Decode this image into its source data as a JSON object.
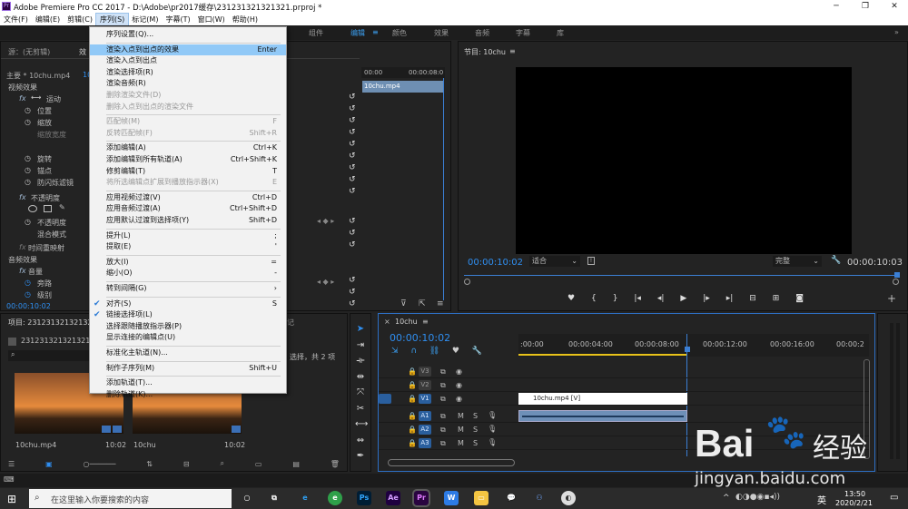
{
  "titlebar": {
    "title": "Adobe Premiere Pro CC 2017 - D:\\Adobe\\pr2017缓存\\231231321321321.prproj *",
    "minimize": "─",
    "restore": "❐",
    "close": "✕"
  },
  "menubar": [
    "文件(F)",
    "编辑(E)",
    "剪辑(C)",
    "序列(S)",
    "标记(M)",
    "字幕(T)",
    "窗口(W)",
    "帮助(H)"
  ],
  "workspaces": [
    "组件",
    "编辑",
    "颜色",
    "效果",
    "音频",
    "字幕",
    "库"
  ],
  "effect_controls": {
    "source_tab": "源：(无剪辑)",
    "effects_tab": "效",
    "master": "主要 * 10chu.mp4",
    "video_effects": "视频效果",
    "audio_effects": "音频效果",
    "timecode": "00:00:10:02",
    "motion": "运动",
    "position": "位置",
    "scale": "缩放",
    "scale_width": "缩放宽度",
    "rotation": "旋转",
    "anchor": "锚点",
    "anti_flicker": "防闪烁滤镜",
    "opacity": "不透明度",
    "opacity2": "不透明度",
    "blend": "混合模式",
    "time_remap": "时间重映射",
    "volume": "音量",
    "bypass": "旁路",
    "level": "级别",
    "mini_tc_start": "00:00",
    "mini_tc_end": "00:00:08:0",
    "clip": "10chu.mp4"
  },
  "program": {
    "tab": "节目: 10chu",
    "timecode": "00:00:10:02",
    "fit": "适合",
    "quality": "完整",
    "duration": "00:00:10:03"
  },
  "project": {
    "tab": "项目: 231231321321321",
    "tab2": "记",
    "name": "231231321321321.prproj",
    "selection_info": "选择，共 2 项",
    "items": [
      {
        "name": "10chu.mp4",
        "dur": "10:02"
      },
      {
        "name": "10chu",
        "dur": "10:02"
      }
    ]
  },
  "timeline": {
    "tab": "10chu",
    "timecode": "00:00:10:02",
    "ruler": [
      ":00:00",
      "00:00:04:00",
      "00:00:08:00",
      "00:00:12:00",
      "00:00:16:00",
      "00:00:2"
    ],
    "tracks": [
      {
        "name": "V3"
      },
      {
        "name": "V2"
      },
      {
        "name": "V1",
        "clip": "10chu.mp4 [V]"
      },
      {
        "name": "A1"
      },
      {
        "name": "A2"
      },
      {
        "name": "A3"
      }
    ]
  },
  "menu": {
    "items": [
      {
        "label": "序列设置(Q)...",
        "sc": "",
        "state": "normal"
      },
      {
        "sep": true
      },
      {
        "label": "渲染入点到出点的效果",
        "sc": "Enter",
        "state": "hl"
      },
      {
        "label": "渲染入点到出点",
        "sc": "",
        "state": "normal"
      },
      {
        "label": "渲染选择项(R)",
        "sc": "",
        "state": "normal"
      },
      {
        "label": "渲染音频(R)",
        "sc": "",
        "state": "normal"
      },
      {
        "label": "删除渲染文件(D)",
        "sc": "",
        "state": "dis"
      },
      {
        "label": "删除入点到出点的渲染文件",
        "sc": "",
        "state": "dis"
      },
      {
        "sep": true
      },
      {
        "label": "匹配帧(M)",
        "sc": "F",
        "state": "dis"
      },
      {
        "label": "反转匹配帧(F)",
        "sc": "Shift+R",
        "state": "dis"
      },
      {
        "sep": true
      },
      {
        "label": "添加编辑(A)",
        "sc": "Ctrl+K",
        "state": "normal"
      },
      {
        "label": "添加编辑到所有轨道(A)",
        "sc": "Ctrl+Shift+K",
        "state": "normal"
      },
      {
        "label": "修剪编辑(T)",
        "sc": "T",
        "state": "normal"
      },
      {
        "label": "将所选编辑点扩展到播放指示器(X)",
        "sc": "E",
        "state": "dis"
      },
      {
        "sep": true
      },
      {
        "label": "应用视频过渡(V)",
        "sc": "Ctrl+D",
        "state": "normal"
      },
      {
        "label": "应用音频过渡(A)",
        "sc": "Ctrl+Shift+D",
        "state": "normal"
      },
      {
        "label": "应用默认过渡到选择项(Y)",
        "sc": "Shift+D",
        "state": "normal"
      },
      {
        "sep": true
      },
      {
        "label": "提升(L)",
        "sc": ";",
        "state": "normal"
      },
      {
        "label": "提取(E)",
        "sc": "'",
        "state": "normal"
      },
      {
        "sep": true
      },
      {
        "label": "放大(I)",
        "sc": "=",
        "state": "normal"
      },
      {
        "label": "缩小(O)",
        "sc": "-",
        "state": "normal"
      },
      {
        "sep": true
      },
      {
        "label": "转到间隔(G)",
        "sc": "›",
        "state": "normal"
      },
      {
        "sep": true
      },
      {
        "label": "对齐(S)",
        "sc": "S",
        "state": "chk"
      },
      {
        "label": "链接选择项(L)",
        "sc": "",
        "state": "chk"
      },
      {
        "label": "选择跟随播放指示器(P)",
        "sc": "",
        "state": "normal"
      },
      {
        "label": "显示连接的编辑点(U)",
        "sc": "",
        "state": "normal"
      },
      {
        "sep": true
      },
      {
        "label": "标准化主轨道(N)...",
        "sc": "",
        "state": "normal"
      },
      {
        "sep": true
      },
      {
        "label": "制作子序列(M)",
        "sc": "Shift+U",
        "state": "normal"
      },
      {
        "sep": true
      },
      {
        "label": "添加轨道(T)...",
        "sc": "",
        "state": "normal"
      },
      {
        "label": "删除轨道(K)...",
        "sc": "",
        "state": "normal"
      }
    ]
  },
  "taskbar": {
    "search_placeholder": "在这里输入你要搜索的内容",
    "time": "13:50",
    "date": "2020/2/21",
    "ime": "英"
  },
  "watermark": {
    "brand": "Bai",
    "brand2": "经验",
    "url": "jingyan.baidu.com"
  }
}
